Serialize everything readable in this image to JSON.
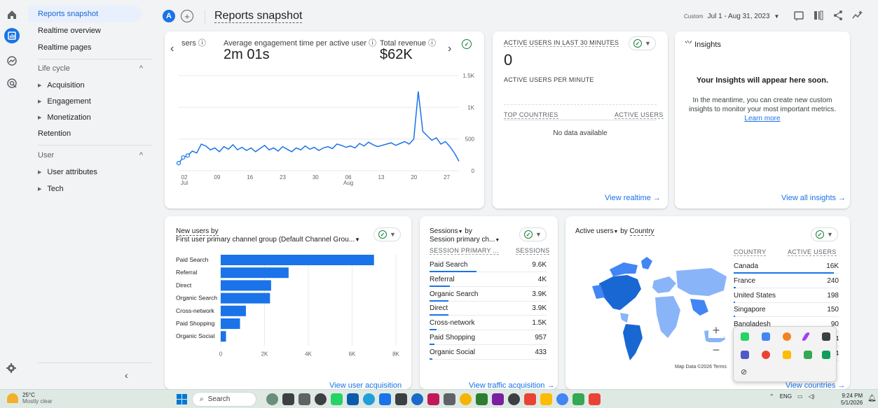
{
  "header": {
    "avatar_letter": "A",
    "add_symbol": "+",
    "title": "Reports snapshot",
    "date_prefix": "Custom",
    "date_range": "Jul 1 - Aug 31, 2023"
  },
  "nav": {
    "items_top": [
      {
        "label": "Reports snapshot",
        "active": true
      },
      {
        "label": "Realtime overview"
      },
      {
        "label": "Realtime pages"
      }
    ],
    "lifecycle_section": "Life cycle",
    "lifecycle_items": [
      "Acquisition",
      "Engagement",
      "Monetization",
      "Retention"
    ],
    "user_section": "User",
    "user_items": [
      "User attributes",
      "Tech"
    ],
    "collapse_symbol": "‹"
  },
  "main_card": {
    "metric1_label": "sers",
    "metric2_label": "Average engagement time per active user",
    "metric2_value": "2m 01s",
    "metric3_label": "Total revenue",
    "metric3_value": "$62K",
    "left_arrow": "‹",
    "right_arrow": "›"
  },
  "chart_data": {
    "type": "line",
    "x_ticks": [
      "02",
      "09",
      "16",
      "23",
      "30",
      "06",
      "13",
      "20",
      "27"
    ],
    "x_tick_months": {
      "02": "Jul",
      "06": "Aug"
    },
    "y_ticks": [
      "1.5K",
      "1K",
      "500",
      "0"
    ],
    "ylim": [
      0,
      1500
    ],
    "series": [
      {
        "values": [
          120,
          210,
          240,
          310,
          280,
          420,
          390,
          330,
          360,
          300,
          380,
          340,
          410,
          330,
          370,
          320,
          360,
          300,
          350,
          400,
          330,
          360,
          310,
          380,
          340,
          300,
          360,
          330,
          390,
          340,
          370,
          320,
          360,
          380,
          350,
          420,
          400,
          370,
          390,
          360,
          430,
          390,
          450,
          410,
          380,
          400,
          420,
          440,
          400,
          430,
          460,
          420,
          500,
          1250,
          620,
          550,
          480,
          520,
          420,
          460,
          380,
          280,
          150
        ]
      }
    ],
    "color": "#1a73e8"
  },
  "realtime_card": {
    "title": "ACTIVE USERS IN LAST 30 MINUTES",
    "value": "0",
    "per_minute_label": "ACTIVE USERS PER MINUTE",
    "col1": "TOP COUNTRIES",
    "col2": "ACTIVE USERS",
    "empty_text": "No data available",
    "link": "View realtime"
  },
  "insights_card": {
    "title": "Insights",
    "heading": "Your Insights will appear here soon.",
    "body": "In the meantime, you can create new custom insights to monitor your most important metrics.",
    "learn_more": "Learn more",
    "link": "View all insights"
  },
  "new_users_card": {
    "title_line1": "New users by",
    "title_line2": "First user primary channel group (Default Channel Grou...",
    "link": "View user acquisition",
    "bar_chart": {
      "type": "bar",
      "categories": [
        "Paid Search",
        "Referral",
        "Direct",
        "Organic Search",
        "Cross-network",
        "Paid Shopping",
        "Organic Social"
      ],
      "values": [
        7000,
        3100,
        2300,
        2250,
        1150,
        880,
        240
      ],
      "x_ticks": [
        "0",
        "2K",
        "4K",
        "6K",
        "8K"
      ],
      "xlim": [
        0,
        8000
      ],
      "color": "#1a73e8"
    }
  },
  "sessions_card": {
    "title_line1": "Sessions",
    "title_by": "by",
    "title_line2": "Session primary ch...",
    "col1": "SESSION PRIMARY ...",
    "col2": "SESSIONS",
    "rows": [
      {
        "label": "Paid Search",
        "value": "9.6K",
        "frac": 0.4
      },
      {
        "label": "Referral",
        "value": "4K",
        "frac": 0.17
      },
      {
        "label": "Organic Search",
        "value": "3.9K",
        "frac": 0.16
      },
      {
        "label": "Direct",
        "value": "3.9K",
        "frac": 0.16
      },
      {
        "label": "Cross-network",
        "value": "1.5K",
        "frac": 0.06
      },
      {
        "label": "Paid Shopping",
        "value": "957",
        "frac": 0.04
      },
      {
        "label": "Organic Social",
        "value": "433",
        "frac": 0.02
      }
    ],
    "link": "View traffic acquisition"
  },
  "country_card": {
    "title_metric": "Active users",
    "title_by": "by",
    "title_dim": "Country",
    "col1": "COUNTRY",
    "col2": "ACTIVE USERS",
    "rows": [
      {
        "label": "Canada",
        "value": "16K",
        "frac": 0.95
      },
      {
        "label": "France",
        "value": "240",
        "frac": 0.02
      },
      {
        "label": "United States",
        "value": "198",
        "frac": 0.015
      },
      {
        "label": "Singapore",
        "value": "150",
        "frac": 0.01
      },
      {
        "label": "Bangladesh",
        "value": "90",
        "frac": 0.006
      },
      {
        "label": "",
        "value": "64",
        "frac": 0.004
      },
      {
        "label": "",
        "value": "24",
        "frac": 0.002
      }
    ],
    "map_credit": "Map Data ©2026",
    "map_terms": "Terms",
    "zoom_in": "+",
    "zoom_out": "−",
    "link": "View countries"
  },
  "taskbar": {
    "temp": "25°C",
    "weather": "Mostly clear",
    "search_placeholder": "Search",
    "lang": "ENG",
    "time": "9:24 PM",
    "date": "5/1/2026"
  },
  "colors": {
    "accent": "#1a73e8",
    "map_dark": "#1967d2",
    "map_light": "#8ab4f8"
  }
}
